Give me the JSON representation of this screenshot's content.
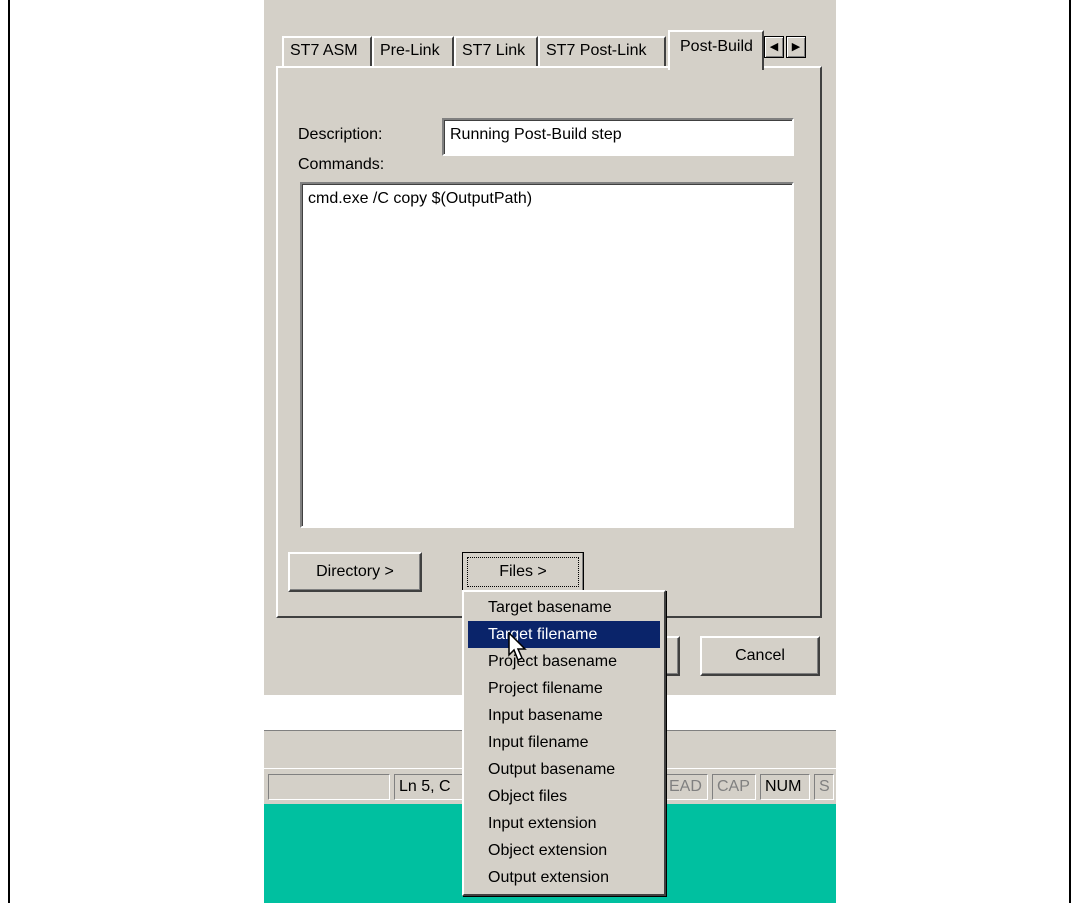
{
  "tabs": [
    {
      "label": "ST7 ASM",
      "selected": false
    },
    {
      "label": "Pre-Link",
      "selected": false
    },
    {
      "label": "ST7 Link",
      "selected": false
    },
    {
      "label": "ST7 Post-Link",
      "selected": false
    },
    {
      "label": "Post-Build",
      "selected": true
    }
  ],
  "tab_scroll": {
    "left_icon": "scroll-left-arrow-icon",
    "right_icon": "scroll-right-arrow-icon"
  },
  "description": {
    "label": "Description:",
    "value": "Running Post-Build step"
  },
  "commands": {
    "label": "Commands:",
    "value": "cmd.exe /C copy $(OutputPath)"
  },
  "buttons": {
    "directory": "Directory >",
    "files": "Files >",
    "cancel": "Cancel"
  },
  "files_menu": {
    "items": [
      "Target basename",
      "Target filename",
      "Project basename",
      "Project filename",
      "Input basename",
      "Input filename",
      "Output basename",
      "Object files",
      "Input extension",
      "Object extension",
      "Output extension"
    ],
    "highlighted_index": 1
  },
  "statusbar": {
    "position": "Ln 5, C",
    "read": "EAD",
    "cap": "CAP",
    "num": "NUM",
    "scrl": "S"
  },
  "colors": {
    "dialog": "#d4d0c8",
    "highlight": "#0a246a",
    "teal": "#00c0a0"
  }
}
